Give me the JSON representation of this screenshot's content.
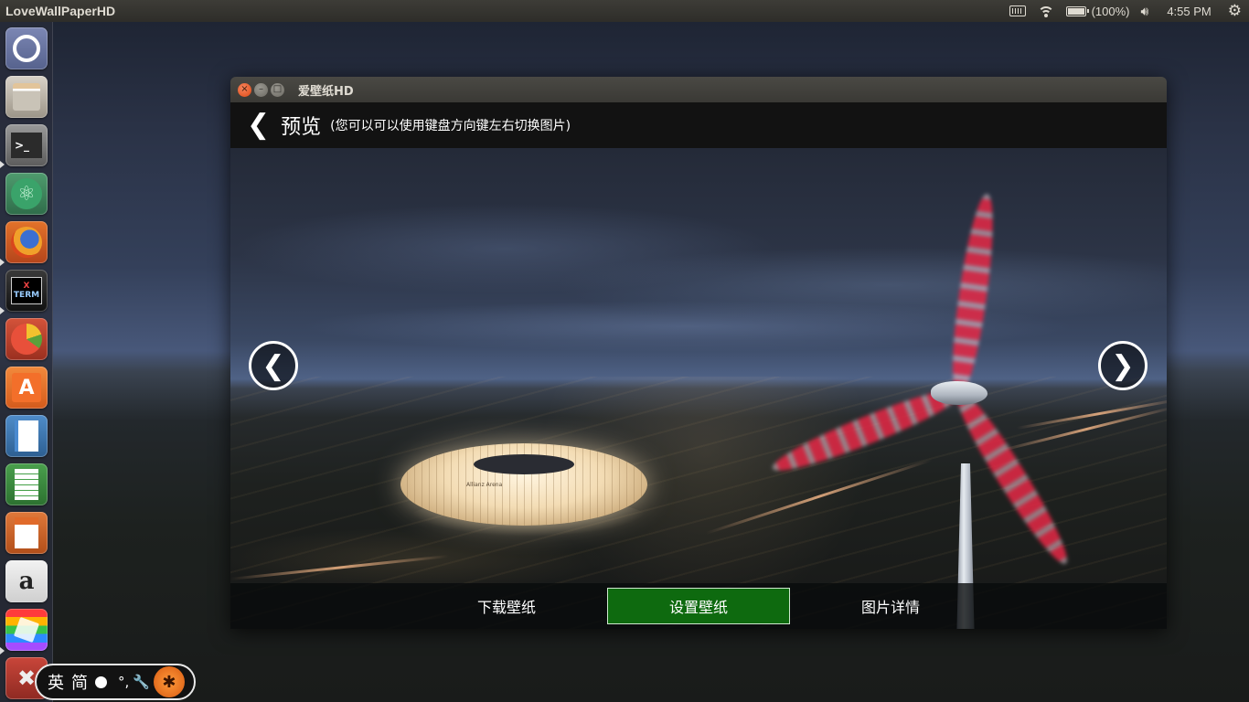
{
  "desktop": {
    "top_panel": {
      "app_title": "LoveWallPaperHD",
      "battery_text": "(100%)",
      "battery_level": 1.0,
      "clock": "4:55 PM",
      "icons": [
        "keyboard-icon",
        "wifi-icon",
        "battery-icon",
        "volume-icon",
        "gear-icon"
      ]
    },
    "launcher": {
      "items": [
        {
          "name": "ubuntu-dash",
          "icon": "ubuntu-logo-icon",
          "running": false
        },
        {
          "name": "files",
          "icon": "file-cabinet-icon",
          "running": false
        },
        {
          "name": "terminal",
          "icon": "terminal-icon",
          "running": true,
          "glyph": ">_"
        },
        {
          "name": "atom",
          "icon": "atom-icon",
          "running": false
        },
        {
          "name": "firefox",
          "icon": "firefox-icon",
          "running": true
        },
        {
          "name": "xterm",
          "icon": "xterm-icon",
          "running": true,
          "glyph": "X TERM"
        },
        {
          "name": "disk-usage",
          "icon": "pie-chart-icon",
          "running": false
        },
        {
          "name": "software-center",
          "icon": "shopping-bag-icon",
          "running": false,
          "glyph": "A"
        },
        {
          "name": "libreoffice-writer",
          "icon": "document-icon",
          "running": false
        },
        {
          "name": "libreoffice-calc",
          "icon": "spreadsheet-icon",
          "running": false
        },
        {
          "name": "libreoffice-impress",
          "icon": "presentation-icon",
          "running": false
        },
        {
          "name": "amazon",
          "icon": "amazon-icon",
          "running": false,
          "glyph": "a"
        },
        {
          "name": "wallpaper-app",
          "icon": "color-stripes-icon",
          "running": true
        },
        {
          "name": "settings",
          "icon": "tools-icon",
          "running": false
        }
      ]
    }
  },
  "window": {
    "title": "爱壁纸HD",
    "controls": {
      "close": "×",
      "minimize": "–",
      "maximize": "□"
    },
    "header": {
      "back_glyph": "❮",
      "title": "预览",
      "hint": "(您可以可以使用键盘方向键左右切换图片)"
    },
    "preview": {
      "prev_glyph": "❮",
      "next_glyph": "❯",
      "stadium_sign": "Allianz Arena"
    },
    "actions": {
      "download": "下载壁纸",
      "set": "设置壁纸",
      "details": "图片详情"
    },
    "colors": {
      "accent": "#0e6a0f",
      "header_bg": "#121212",
      "close_btn": "#dd4814"
    }
  },
  "ime": {
    "lang": "英",
    "charset": "简",
    "punct": "°,",
    "wrench": "🔧",
    "logo": "✱"
  }
}
